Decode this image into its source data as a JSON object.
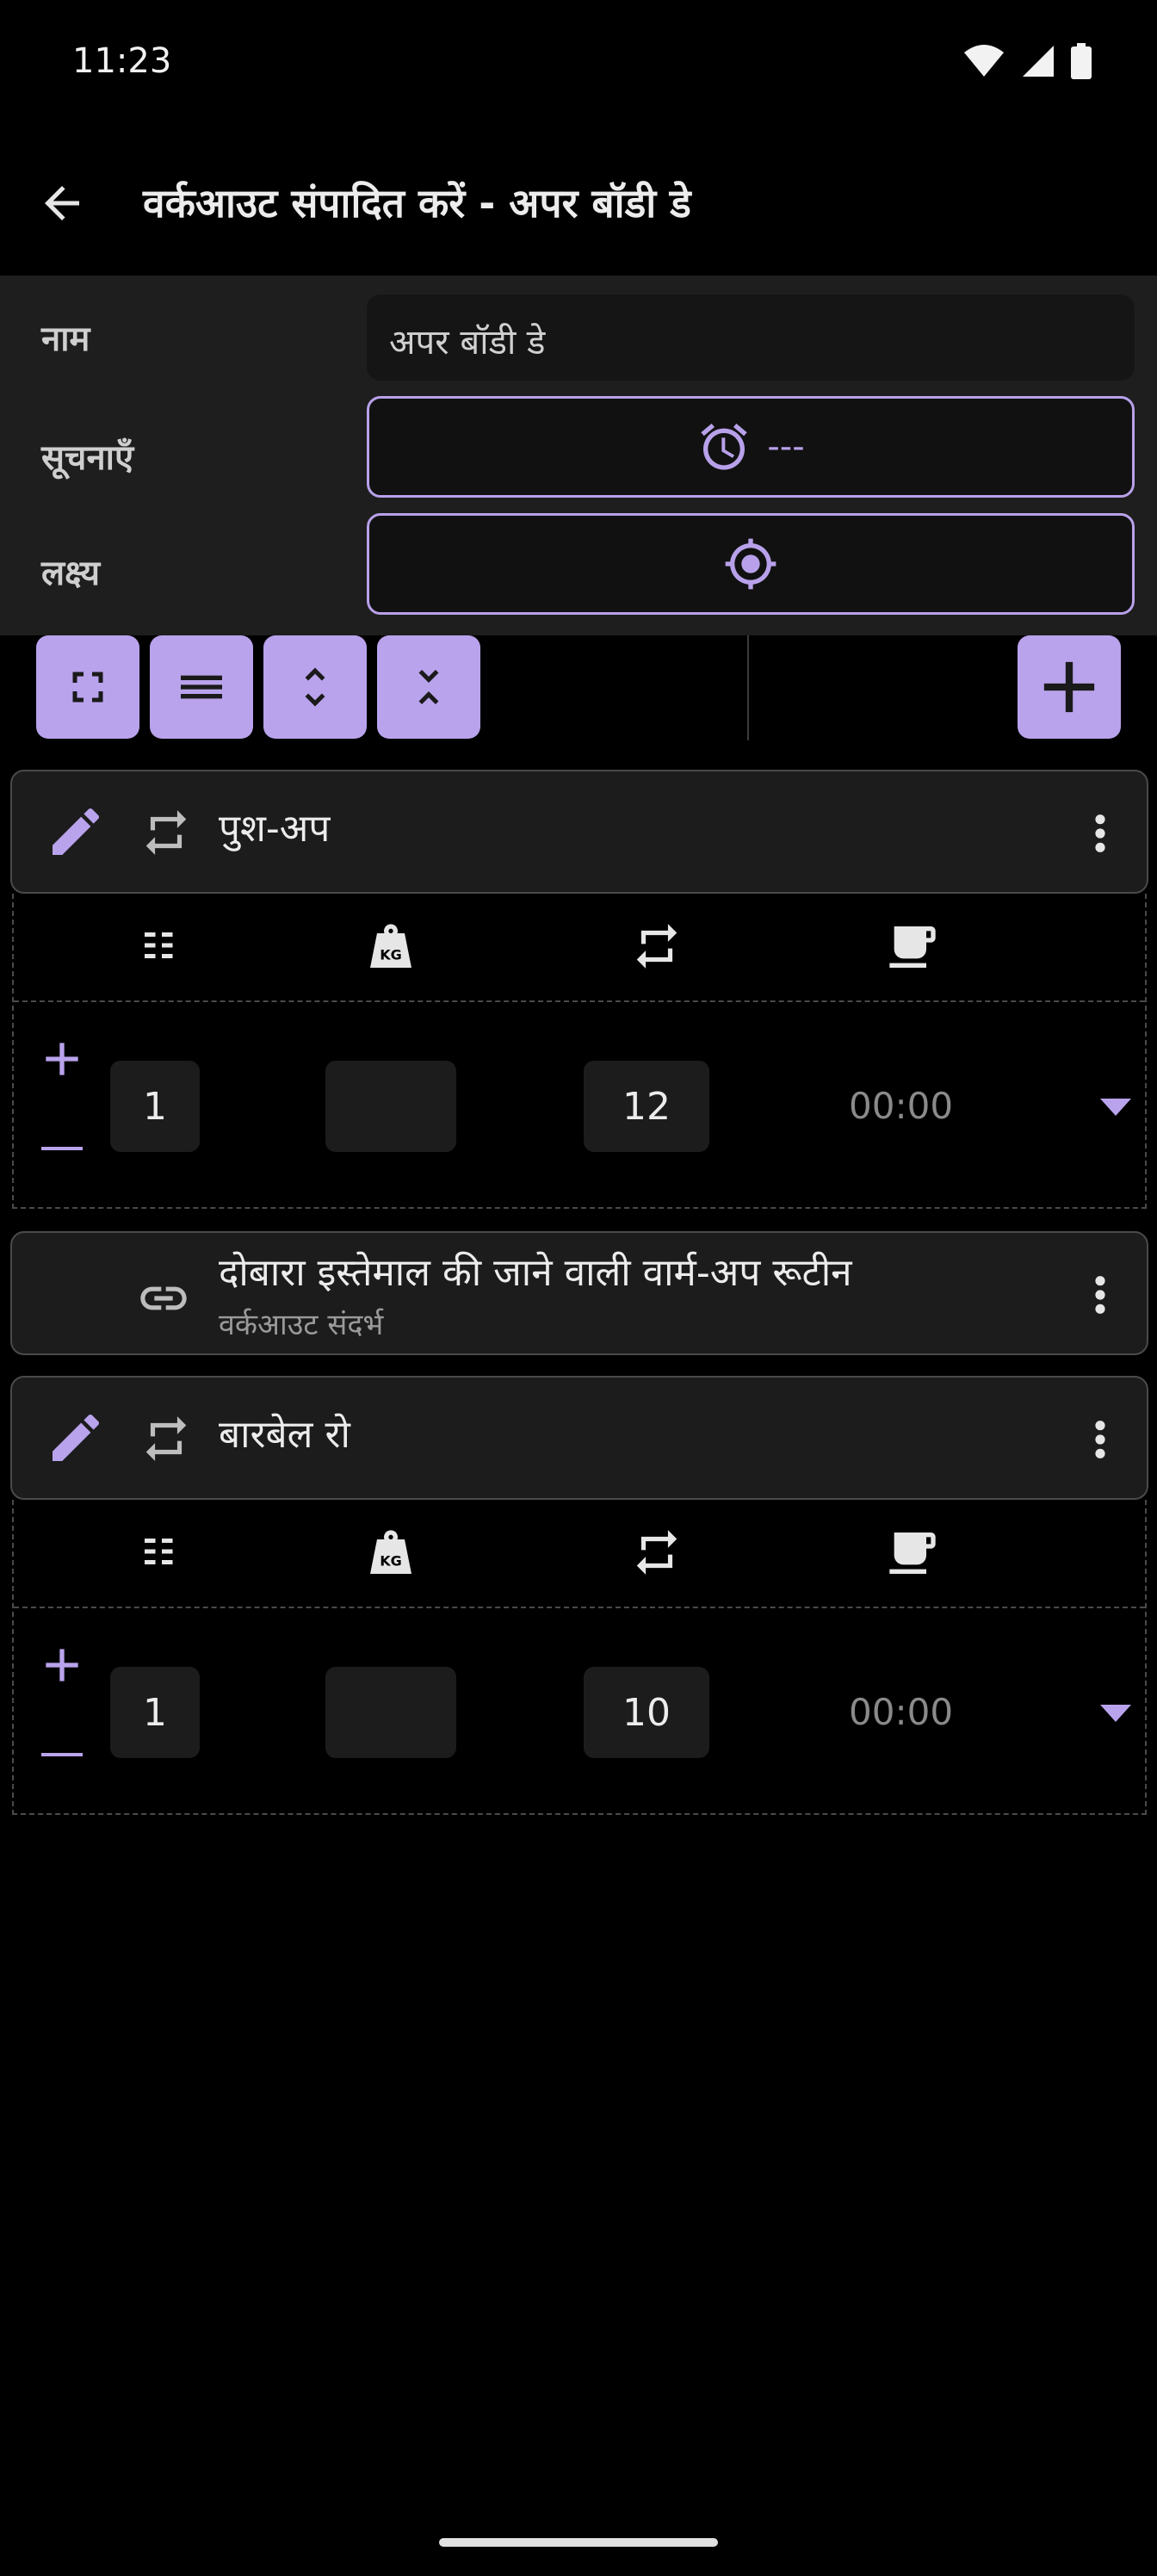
{
  "status_bar": {
    "time": "11:23"
  },
  "app_bar": {
    "title": "वर्कआउट संपादित करें - अपर बॉडी डे"
  },
  "form": {
    "name_label": "नाम",
    "name_value": "अपर बॉडी डे",
    "notifications_label": "सूचनाएँ",
    "notifications_value": "---",
    "goal_label": "लक्ष्य"
  },
  "exercises": [
    {
      "name": "पुश-अप",
      "set": {
        "count": "1",
        "weight": "",
        "reps": "12",
        "rest": "00:00"
      }
    },
    {
      "name": "बारबेल रो",
      "set": {
        "count": "1",
        "weight": "",
        "reps": "10",
        "rest": "00:00"
      }
    }
  ],
  "reference": {
    "title": "दोबारा इस्तेमाल की जाने वाली वार्म-अप रूटीन",
    "subtitle": "वर्कआउट संदर्भ"
  },
  "colors": {
    "accent": "#b9a3ec",
    "surface": "#1e1e1e",
    "card": "#1c1c1c",
    "background": "#000000"
  }
}
